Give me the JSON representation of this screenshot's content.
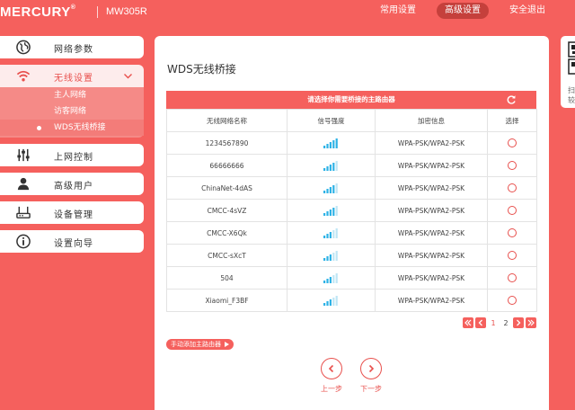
{
  "header": {
    "logo": "MERCURY",
    "logo_mark": "®",
    "model": "MW305R",
    "nav": [
      "常用设置",
      "高级设置",
      "安全退出"
    ],
    "active_nav": 1
  },
  "sidebar": {
    "items": [
      {
        "label": "网络参数",
        "icon": "globe-icon"
      },
      {
        "label": "无线设置",
        "icon": "wifi-icon"
      },
      {
        "label": "上网控制",
        "icon": "sliders-icon"
      },
      {
        "label": "高级用户",
        "icon": "user-icon"
      },
      {
        "label": "设备管理",
        "icon": "router-icon"
      },
      {
        "label": "设置向导",
        "icon": "info-icon"
      }
    ],
    "submenu": [
      "主人网络",
      "访客网络",
      "WDS无线桥接"
    ],
    "active_sub": 2
  },
  "panel": {
    "title": "WDS无线桥接",
    "banner": "请选择你需要桥接的主路由器",
    "columns": [
      "无线网络名称",
      "信号强度",
      "加密信息",
      "选择"
    ],
    "rows": [
      {
        "ssid": "1234567890",
        "signal": 4,
        "security": "WPA-PSK/WPA2-PSK"
      },
      {
        "ssid": "66666666",
        "signal": 3,
        "security": "WPA-PSK/WPA2-PSK"
      },
      {
        "ssid": "ChinaNet-4dAS",
        "signal": 3,
        "security": "WPA-PSK/WPA2-PSK"
      },
      {
        "ssid": "CMCC-4sVZ",
        "signal": 3,
        "security": "WPA-PSK/WPA2-PSK"
      },
      {
        "ssid": "CMCC-X6Qk",
        "signal": 2,
        "security": "WPA-PSK/WPA2-PSK"
      },
      {
        "ssid": "CMCC-sXcT",
        "signal": 2,
        "security": "WPA-PSK/WPA2-PSK"
      },
      {
        "ssid": "504",
        "signal": 2,
        "security": "WPA-PSK/WPA2-PSK"
      },
      {
        "ssid": "Xiaomi_F3BF",
        "signal": 2,
        "security": "WPA-PSK/WPA2-PSK"
      }
    ],
    "pager": {
      "pages": [
        "1",
        "2"
      ],
      "current": 0
    },
    "add_button": "手动添加主路由器",
    "prev_label": "上一步",
    "next_label": "下一步"
  },
  "qr_card": {
    "lines": [
      "扫",
      "较"
    ]
  },
  "colors": {
    "accent": "#f5605d",
    "accent_dark": "#c5403c",
    "signal": "#2db2e6"
  }
}
